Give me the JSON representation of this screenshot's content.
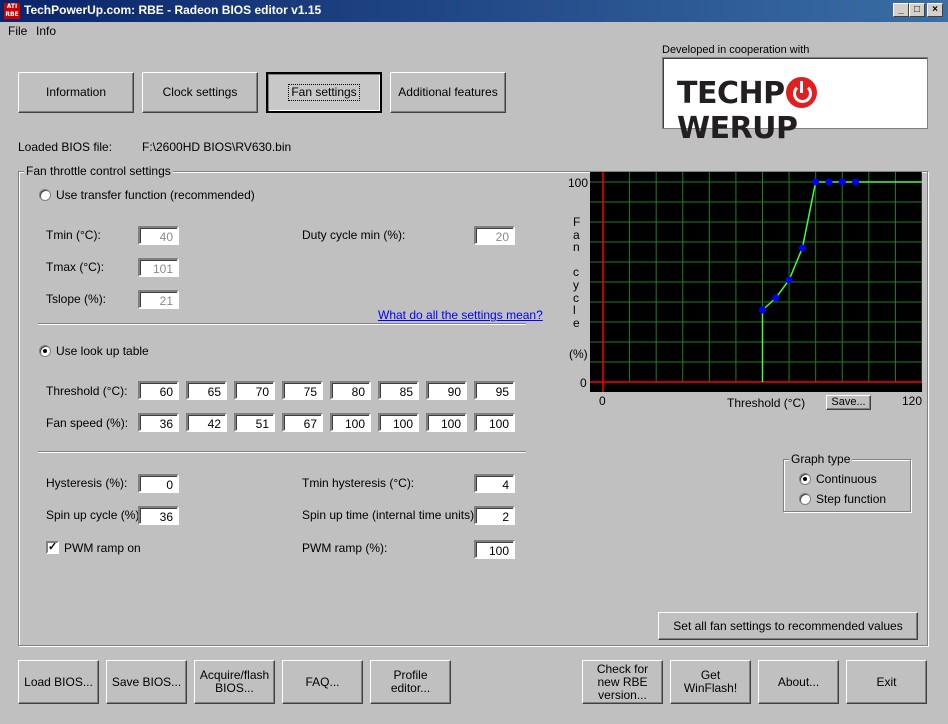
{
  "window": {
    "title": "TechPowerUp.com: RBE - Radeon BIOS editor v1.15",
    "icon_text": "ATI RBE",
    "controls": [
      "_",
      "□",
      "×"
    ]
  },
  "menu": [
    "File",
    "Info"
  ],
  "tabs": [
    {
      "label": "Information"
    },
    {
      "label": "Clock settings"
    },
    {
      "label": "Fan settings",
      "active": true
    },
    {
      "label": "Additional features"
    }
  ],
  "partner": {
    "caption": "Developed in cooperation with",
    "logo_left": "TECHP",
    "logo_right": "WERUP"
  },
  "bios": {
    "label": "Loaded BIOS file:",
    "path": "F:\\2600HD BIOS\\RV630.bin"
  },
  "fan": {
    "group_title": "Fan throttle control settings",
    "transfer": {
      "radio_label": "Use transfer function (recommended)",
      "selected": false,
      "tmin_label": "Tmin (°C):",
      "tmin": "40",
      "tmax_label": "Tmax (°C):",
      "tmax": "101",
      "tslope_label": "Tslope (%):",
      "tslope": "21",
      "duty_label": "Duty cycle min (%):",
      "duty": "20"
    },
    "help_link": "What do all the settings mean?",
    "lookup": {
      "radio_label": "Use look up table",
      "selected": true,
      "threshold_label": "Threshold (°C):",
      "thresholds": [
        "60",
        "65",
        "70",
        "75",
        "80",
        "85",
        "90",
        "95"
      ],
      "speed_label": "Fan speed (%):",
      "speeds": [
        "36",
        "42",
        "51",
        "67",
        "100",
        "100",
        "100",
        "100"
      ]
    },
    "extra": {
      "hysteresis_label": "Hysteresis (%):",
      "hysteresis": "0",
      "spinup_label": "Spin up cycle (%):",
      "spinup": "36",
      "pwm_ramp_on_label": "PWM ramp on",
      "pwm_ramp_on": true,
      "tmin_hyst_label": "Tmin hysteresis (°C):",
      "tmin_hyst": "4",
      "spinup_time_label": "Spin up time (internal time units):",
      "spinup_time": "2",
      "pwm_ramp_label": "PWM ramp (%):",
      "pwm_ramp": "100"
    }
  },
  "chart_data": {
    "type": "line",
    "x": [
      60,
      65,
      70,
      75,
      80,
      85,
      90,
      95
    ],
    "y": [
      36,
      42,
      51,
      67,
      100,
      100,
      100,
      100
    ],
    "xlim": [
      0,
      120
    ],
    "ylim": [
      0,
      100
    ],
    "xlabel": "Threshold (°C)",
    "ylabel_chars": [
      "F",
      "a",
      "n",
      "",
      "c",
      "y",
      "c",
      "l",
      "e",
      "",
      "(%)"
    ],
    "x_ticks": [
      "0",
      "120"
    ],
    "y_ticks": [
      "100",
      "0"
    ],
    "grid": true,
    "colors": {
      "background": "#000000",
      "grid": "#208020",
      "line": "#40ff40",
      "point": "#0000ff",
      "axis": "#ff0000"
    }
  },
  "graph": {
    "save_label": "Save...",
    "type_title": "Graph type",
    "continuous_label": "Continuous",
    "step_label": "Step function",
    "continuous_selected": true
  },
  "recommended_label": "Set all fan settings to recommended values",
  "bottom_buttons": {
    "load": "Load BIOS...",
    "save": "Save BIOS...",
    "acquire": "Acquire/flash BIOS...",
    "faq": "FAQ...",
    "profile": "Profile editor...",
    "check": "Check for new RBE version...",
    "winflash": "Get WinFlash!",
    "about": "About...",
    "exit": "Exit"
  }
}
